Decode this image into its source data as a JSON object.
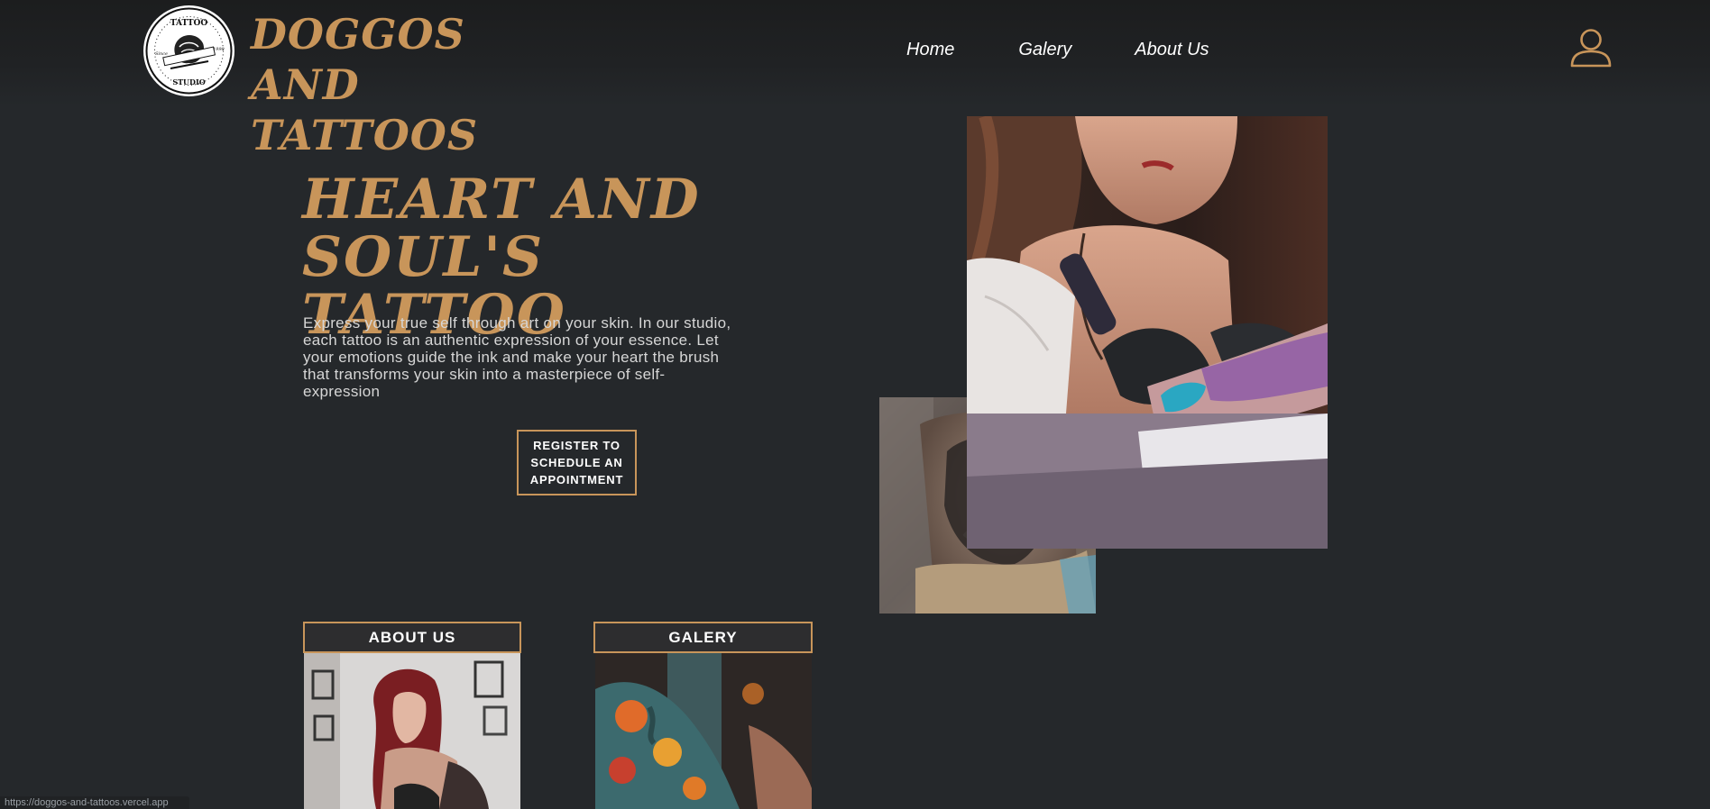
{
  "header": {
    "brand_title": "DOGGOS AND TATTOOS",
    "logo": {
      "top_text": "TATTOO",
      "bottom_text": "STUDIO",
      "left_text": "Since",
      "right_text": "1990"
    },
    "nav": [
      {
        "label": "Home"
      },
      {
        "label": "Galery"
      },
      {
        "label": "About Us"
      }
    ],
    "user_icon": "user-icon"
  },
  "hero": {
    "title": "HEART AND SOUL'S TATTOO",
    "description": "Express your true self through art on your skin. In our studio, each tattoo is an authentic expression of your essence. Let your emotions guide the ink and make your heart the brush that transforms your skin into a masterpiece of self-expression",
    "cta_label": "REGISTER TO SCHEDULE AN APPOINTMENT"
  },
  "cards": [
    {
      "label": "ABOUT US"
    },
    {
      "label": "GALERY"
    }
  ],
  "status_bar": {
    "url": "https://doggos-and-tattoos.vercel.app"
  },
  "colors": {
    "background": "#25282b",
    "accent": "#c8955a",
    "text": "#ffffff"
  }
}
